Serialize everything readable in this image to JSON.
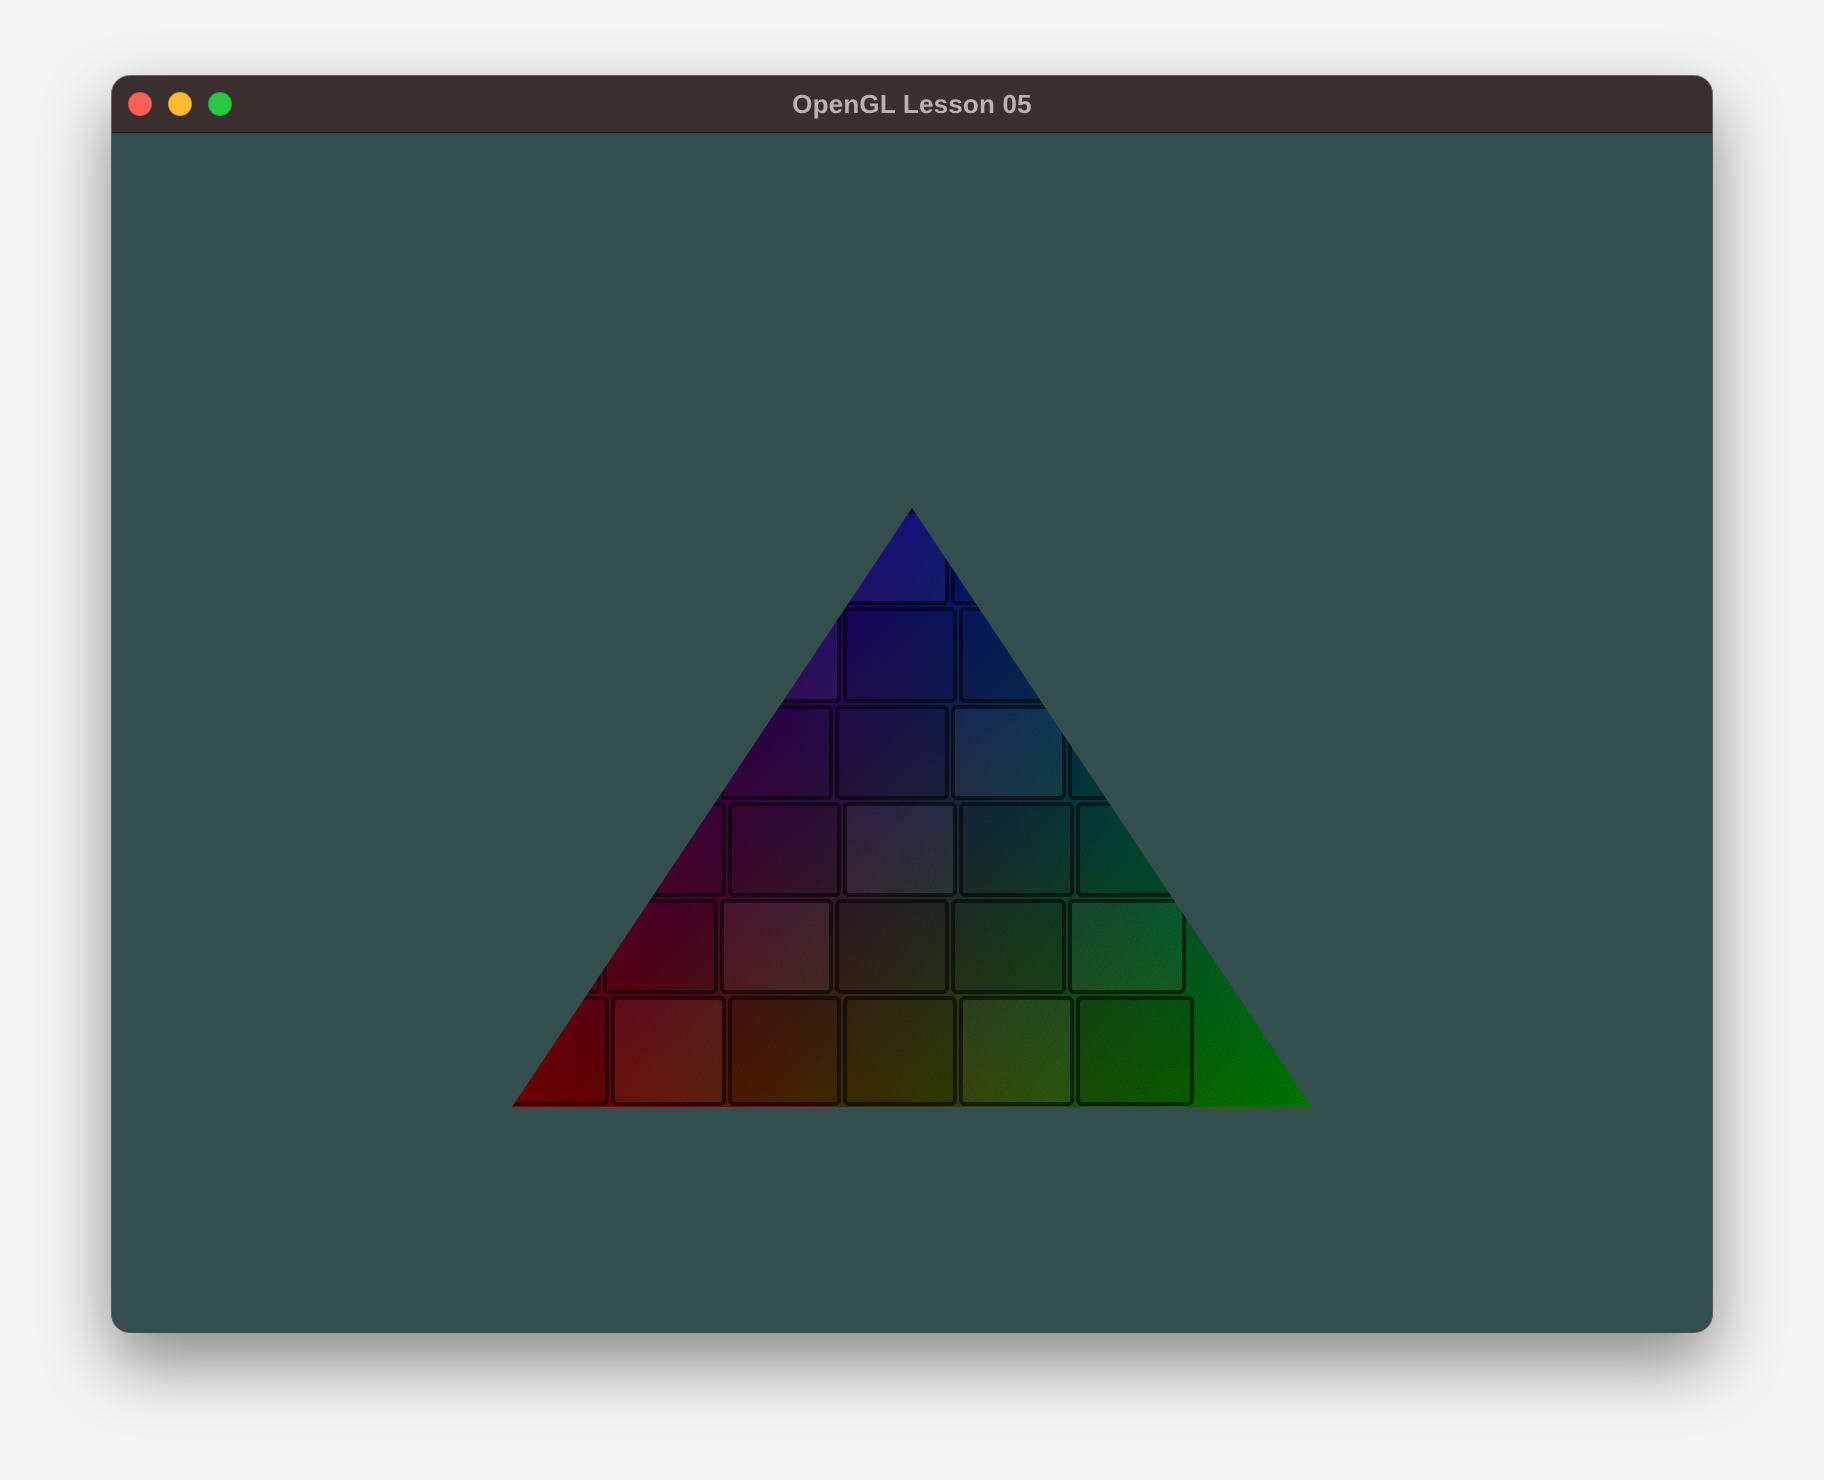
{
  "window": {
    "title": "OpenGL Lesson 05"
  },
  "colors": {
    "clear_color": "#344e4e",
    "titlebar": "#3a2f2f",
    "vertex_top": "#0000ff",
    "vertex_left": "#ff0000",
    "vertex_right": "#00ff00"
  },
  "icons": {
    "close": "close-icon",
    "minimize": "minimize-icon",
    "zoom": "zoom-icon"
  }
}
